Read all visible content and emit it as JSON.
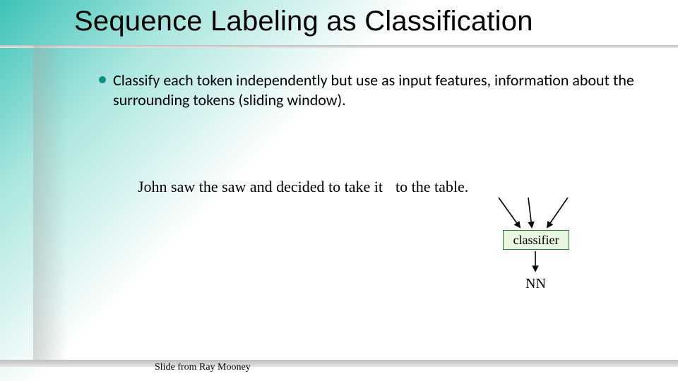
{
  "title": "Sequence Labeling as Classification",
  "bullet": "Classify each token independently but use as input features, information about the surrounding tokens (sliding window).",
  "sentence": {
    "left": "John  saw  the  saw  and  decided  to  take  it",
    "right": "to  the  table."
  },
  "classifier_label": "classifier",
  "output_tag": "NN",
  "credit": "Slide from Ray Mooney"
}
